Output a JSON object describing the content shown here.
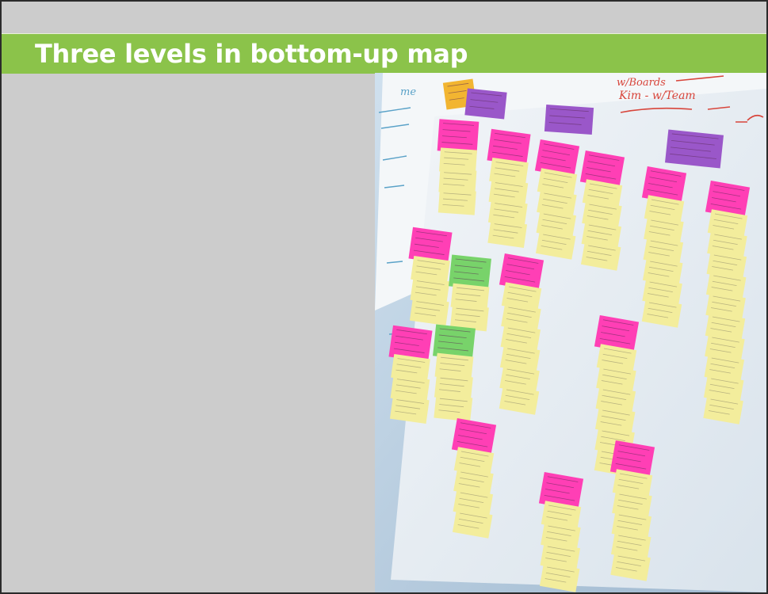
{
  "slide": {
    "title": "Three levels in bottom-up map"
  },
  "photo": {
    "description_icon": "affinity-diagram-photo",
    "colors": {
      "wall": "#b9cee0",
      "board": "#e9eef4",
      "sticky_yellow": "#f3ed9c",
      "sticky_pink": "#ff3fb5",
      "sticky_purple": "#9a57c9",
      "sticky_green": "#78d36a",
      "sticky_orange": "#f2b531",
      "marker_red": "#d8453b"
    },
    "handwriting": [
      "me",
      "Kim - w/Team",
      "w/Boards"
    ]
  }
}
